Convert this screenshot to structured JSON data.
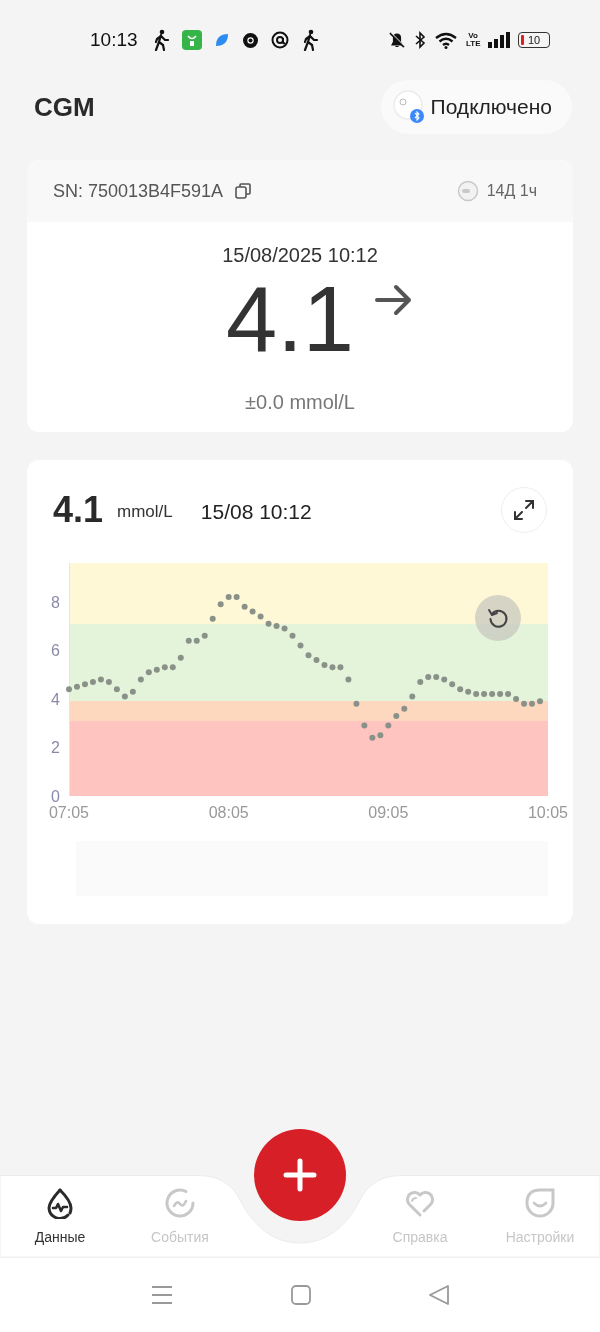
{
  "status_bar": {
    "time": "10:13",
    "network_label": "Vo LTE",
    "battery": "10"
  },
  "header": {
    "title": "CGM",
    "connection": "Подключено"
  },
  "sensor": {
    "serial": "SN: 750013B4F591A",
    "remaining": "14Д 1ч",
    "timestamp": "15/08/2025 10:12",
    "value": "4.1",
    "delta": "±0.0 mmol/L"
  },
  "chart_card": {
    "value": "4.1",
    "unit": "mmol/L",
    "time": "15/08 10:12",
    "chart_data": {
      "type": "scatter",
      "ylim": [
        0,
        9.6
      ],
      "yticks": [
        0,
        2,
        4,
        6,
        8
      ],
      "categories": [
        "07:05",
        null,
        null,
        null,
        null,
        null,
        null,
        null,
        null,
        null,
        null,
        null,
        null,
        null,
        null,
        null,
        null,
        null,
        null,
        null,
        "08:05",
        null,
        null,
        null,
        null,
        null,
        null,
        null,
        null,
        null,
        null,
        null,
        null,
        null,
        null,
        null,
        null,
        null,
        null,
        null,
        "09:05",
        null,
        null,
        null,
        null,
        null,
        null,
        null,
        null,
        null,
        null,
        null,
        null,
        null,
        null,
        null,
        null,
        null,
        null,
        null,
        "10:05"
      ],
      "series": [
        {
          "color": "#8a9189",
          "values": [
            4.4,
            4.5,
            4.6,
            4.7,
            4.8,
            4.7,
            4.4,
            4.1,
            4.3,
            4.8,
            5.1,
            5.2,
            5.3,
            5.3,
            5.7,
            6.4,
            6.4,
            6.6,
            7.3,
            7.9,
            8.2,
            8.2,
            7.8,
            7.6,
            7.4,
            7.1,
            7.0,
            6.9,
            6.6,
            6.2,
            5.8,
            5.6,
            5.4,
            5.3,
            5.3,
            4.8,
            3.8,
            2.9,
            2.4,
            2.5,
            2.9,
            3.3,
            3.6,
            4.1,
            4.7,
            4.9,
            4.9,
            4.8,
            4.6,
            4.4,
            4.3,
            4.2,
            4.2,
            4.2,
            4.2,
            4.2,
            4.0,
            3.8,
            3.8,
            3.9,
            null
          ]
        }
      ]
    }
  },
  "nav": {
    "items": [
      {
        "label": "Данные",
        "kind": "data",
        "selected": true
      },
      {
        "label": "События",
        "kind": "events",
        "selected": false
      },
      {
        "label": "Справка",
        "kind": "help",
        "selected": false
      },
      {
        "label": "Настройки",
        "kind": "settings",
        "selected": false
      }
    ]
  }
}
